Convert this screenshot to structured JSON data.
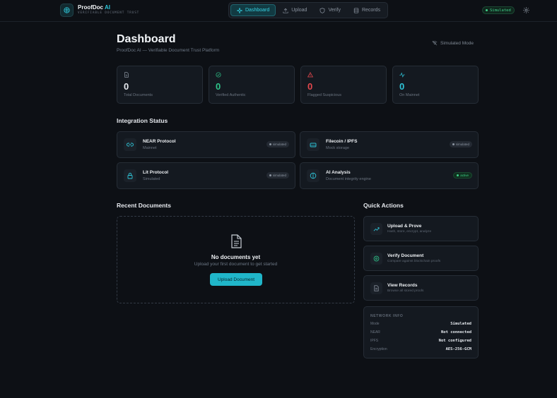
{
  "brand": {
    "name": "ProofDoc",
    "name_accent": "AI",
    "tagline": "VERIFIABLE DOCUMENT TRUST"
  },
  "nav": [
    {
      "label": "Dashboard",
      "icon": "sparkle-icon",
      "active": true
    },
    {
      "label": "Upload",
      "icon": "upload-icon",
      "active": false
    },
    {
      "label": "Verify",
      "icon": "shield-icon",
      "active": false
    },
    {
      "label": "Records",
      "icon": "database-icon",
      "active": false
    }
  ],
  "header_status": "Simulated",
  "page": {
    "title": "Dashboard",
    "subtitle": "ProofDoc AI — Verifiable Document Trust Platform",
    "mode": "Simulated Mode"
  },
  "stats": [
    {
      "value": "0",
      "label": "Total Documents",
      "color": "#e6e9ee",
      "icon": "document-icon"
    },
    {
      "value": "0",
      "label": "Verified Authentic",
      "color": "#2ec58a",
      "icon": "check-circle-icon"
    },
    {
      "value": "0",
      "label": "Flagged Suspicious",
      "color": "#e5484d",
      "icon": "warning-icon"
    },
    {
      "value": "0",
      "label": "On Mainnet",
      "color": "#2ec5d8",
      "icon": "activity-icon"
    }
  ],
  "integration": {
    "title": "Integration Status",
    "items": [
      {
        "name": "NEAR Protocol",
        "sub": "Mainnet",
        "badge": "simulated",
        "icon": "link-icon"
      },
      {
        "name": "Filecoin / IPFS",
        "sub": "Mock storage",
        "badge": "simulated",
        "icon": "storage-icon"
      },
      {
        "name": "Lit Protocol",
        "sub": "Simulated",
        "badge": "simulated",
        "icon": "lock-icon"
      },
      {
        "name": "AI Analysis",
        "sub": "Document integrity engine",
        "badge": "active",
        "icon": "brain-icon"
      }
    ]
  },
  "recent": {
    "title": "Recent Documents",
    "empty_title": "No documents yet",
    "empty_sub": "Upload your first document to get started",
    "button": "Upload Document"
  },
  "quick": {
    "title": "Quick Actions",
    "items": [
      {
        "title": "Upload & Prove",
        "sub": "Hash, store, encrypt, analyze",
        "icon": "trend-icon"
      },
      {
        "title": "Verify Document",
        "sub": "Compare against blockchain proofs",
        "icon": "verify-icon"
      },
      {
        "title": "View Records",
        "sub": "Browse all stored proofs",
        "icon": "file-icon"
      }
    ]
  },
  "network": {
    "title": "NETWORK INFO",
    "rows": [
      {
        "key": "Mode",
        "value": "Simulated"
      },
      {
        "key": "NEAR",
        "value": "Not connected"
      },
      {
        "key": "IPFS",
        "value": "Not configured"
      },
      {
        "key": "Encryption",
        "value": "AES-256-GCM"
      }
    ]
  },
  "colors": {
    "accent": "#2ec5d8",
    "success": "#3fd08a",
    "danger": "#e5484d",
    "bg": "#0d1015",
    "card": "#141920"
  }
}
